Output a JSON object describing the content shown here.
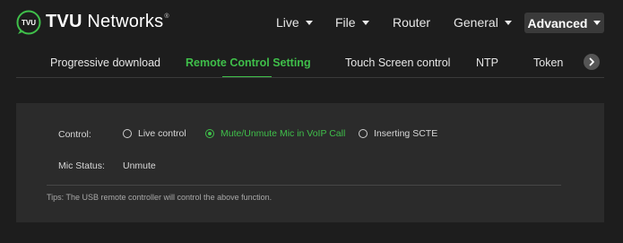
{
  "header": {
    "logo_text": "TVU",
    "brand_name_bold": "TVU",
    "brand_name_rest": " Networks",
    "brand_mark": "®",
    "nav": {
      "live_label": "Live",
      "file_label": "File",
      "router_label": "Router",
      "general_label": "General",
      "advanced_label": "Advanced"
    }
  },
  "tabs": {
    "items": [
      "Progressive download",
      "Remote Control Setting",
      "Touch Screen control",
      "NTP",
      "Token"
    ],
    "active_index": 1,
    "scroll_icon": "chevron-right-icon"
  },
  "settings": {
    "control_label": "Control:",
    "options": [
      "Live control",
      "Mute/Unmute Mic in VoIP Call",
      "Inserting SCTE"
    ],
    "selected_option": "Mute/Unmute Mic in VoIP Call",
    "mic_status_label": "Mic Status:",
    "mic_status_value": "Unmute",
    "tips": "Tips: The USB remote controller will control the above function."
  },
  "colors": {
    "accent": "#3fbf4a",
    "background": "#1d1d1d",
    "panel": "#2b2b2b",
    "active_nav_bg": "#3a3a3a"
  }
}
